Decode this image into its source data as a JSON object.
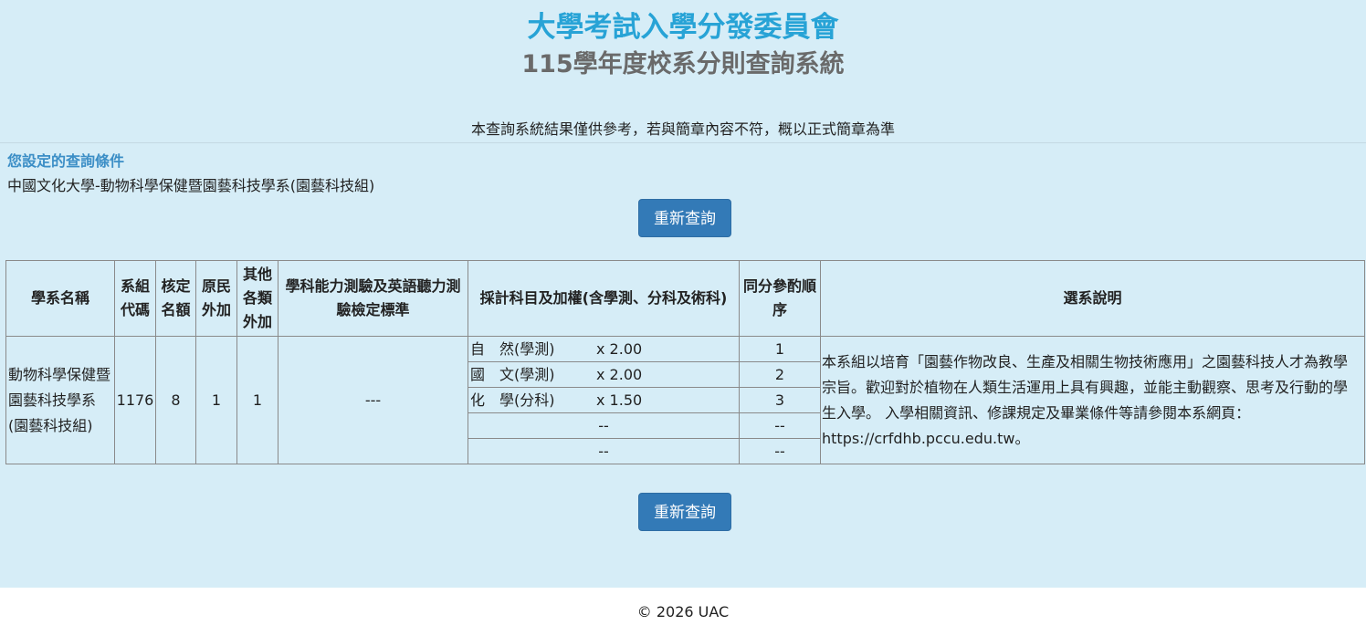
{
  "header": {
    "title": "大學考試入學分發委員會",
    "subtitle": "115學年度校系分則查詢系統",
    "notice": "本查詢系統結果僅供參考，若與簡章內容不符，概以正式簡章為準"
  },
  "conditions": {
    "title": "您設定的查詢條件",
    "value": "中國文化大學-動物科學保健暨園藝科技學系(園藝科技組)"
  },
  "buttons": {
    "requery": "重新查詢"
  },
  "table": {
    "headers": {
      "dept": "學系名稱",
      "code": "系組代碼",
      "quota": "核定名額",
      "indigenous": "原民外加",
      "other": "其他各類外加",
      "standard": "學科能力測驗及英語聽力測驗檢定標準",
      "subjects": "採計科目及加權(含學測、分科及術科)",
      "tie": "同分參酌順序",
      "desc": "選系說明"
    },
    "row": {
      "dept": "動物科學保健暨園藝科技學系(園藝科技組)",
      "code": "1176",
      "quota": "8",
      "indigenous": "1",
      "other": "1",
      "standard": "---",
      "subjects": [
        {
          "name": "自　然(學測)",
          "weight": "x 2.00",
          "rank": "1"
        },
        {
          "name": "國　文(學測)",
          "weight": "x 2.00",
          "rank": "2"
        },
        {
          "name": "化　學(分科)",
          "weight": "x 1.50",
          "rank": "3"
        },
        {
          "name": "",
          "weight": "--",
          "rank": "--"
        },
        {
          "name": "",
          "weight": "--",
          "rank": "--"
        }
      ],
      "desc": "本系組以培育「園藝作物改良、生產及相關生物技術應用」之園藝科技人才為教學宗旨。歡迎對於植物在人類生活運用上具有興趣，並能主動觀察、思考及行動的學生入學。 入學相關資訊、修課規定及畢業條件等請參閱本系網頁：https://crfdhb.pccu.edu.tw。"
    }
  },
  "footer": "© 2026 UAC"
}
